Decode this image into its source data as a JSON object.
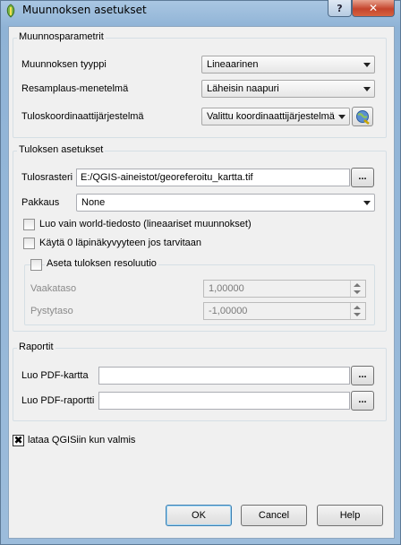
{
  "window": {
    "title": "Muunnoksen asetukset",
    "help_button": "?",
    "close_button": "✕"
  },
  "transform_params": {
    "group_title": "Muunnosparametrit",
    "type_label": "Muunnoksen tyyppi",
    "type_value": "Lineaarinen",
    "resampling_label": "Resamplaus-menetelmä",
    "resampling_value": "Läheisin naapuri",
    "crs_label": "Tuloskoordinaattijärjestelmä",
    "crs_value": "Valittu koordinaattijärjestelmä"
  },
  "output_settings": {
    "group_title": "Tuloksen asetukset",
    "raster_label": "Tulosrasteri",
    "raster_value": "E:/QGIS-aineistot/georeferoitu_kartta.tif",
    "browse_label": "...",
    "compression_label": "Pakkaus",
    "compression_value": "None",
    "world_file_label": "Luo vain world-tiedosto (lineaariset muunnokset)",
    "world_file_checked": false,
    "transparency_label": "Käytä 0 läpinäkyvyyteen jos tarvitaan",
    "transparency_checked": false,
    "resolution": {
      "group_title": "Aseta tuloksen resoluutio",
      "checked": false,
      "horizontal_label": "Vaakataso",
      "horizontal_value": "1,00000",
      "vertical_label": "Pystytaso",
      "vertical_value": "-1,00000"
    }
  },
  "reports": {
    "group_title": "Raportit",
    "pdf_map_label": "Luo PDF-kartta",
    "pdf_map_value": "",
    "pdf_report_label": "Luo PDF-raportti",
    "pdf_report_value": "",
    "browse_label": "..."
  },
  "load_in_qgis": {
    "label": "lataa QGISiin kun valmis",
    "checked": true,
    "mark": "✖"
  },
  "buttons": {
    "ok": "OK",
    "cancel": "Cancel",
    "help": "Help"
  }
}
